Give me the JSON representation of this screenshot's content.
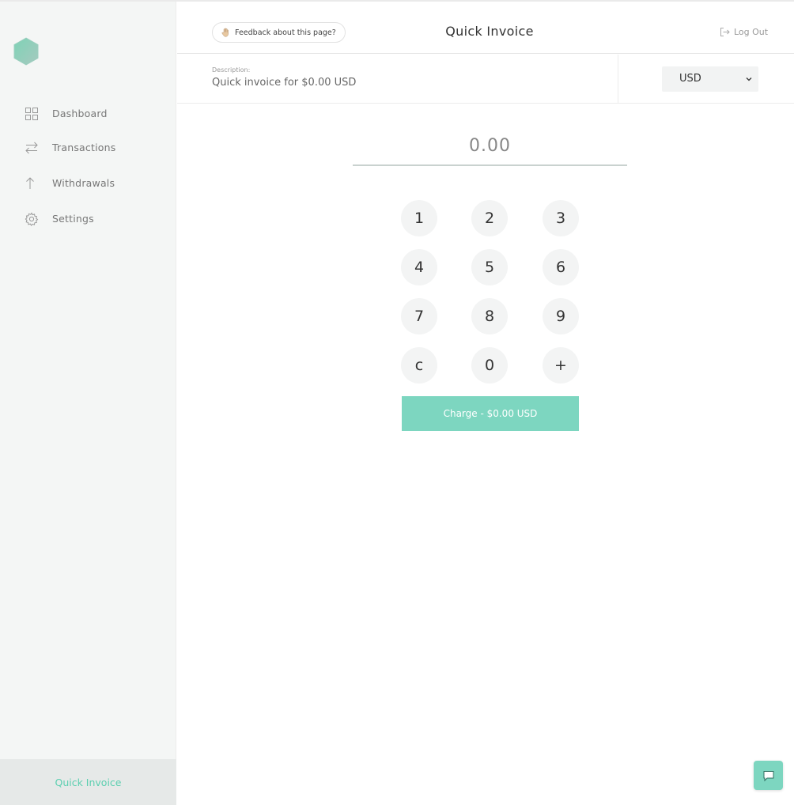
{
  "sidebar": {
    "logo": "hexagon-logo",
    "items": [
      {
        "label": "Dashboard",
        "icon": "grid-icon"
      },
      {
        "label": "Transactions",
        "icon": "arrows-icon"
      },
      {
        "label": "Withdrawals",
        "icon": "arrow-up-icon"
      },
      {
        "label": "Settings",
        "icon": "gear-icon"
      }
    ],
    "footer_label": "Quick Invoice"
  },
  "header": {
    "feedback_label": "Feedback about this page?",
    "title": "Quick Invoice",
    "logout_label": "Log Out"
  },
  "description": {
    "label": "Description:",
    "value": "Quick invoice for $0.00 USD"
  },
  "currency": {
    "selected": "USD"
  },
  "amount": {
    "value": "0.00"
  },
  "keypad": {
    "keys": [
      "1",
      "2",
      "3",
      "4",
      "5",
      "6",
      "7",
      "8",
      "9",
      "c",
      "0",
      "+"
    ]
  },
  "charge": {
    "label": "Charge - $0.00 USD"
  },
  "colors": {
    "accent": "#7dd6c0",
    "accent_text": "#5ccfb0",
    "sidebar_bg": "#f4f6f5"
  }
}
